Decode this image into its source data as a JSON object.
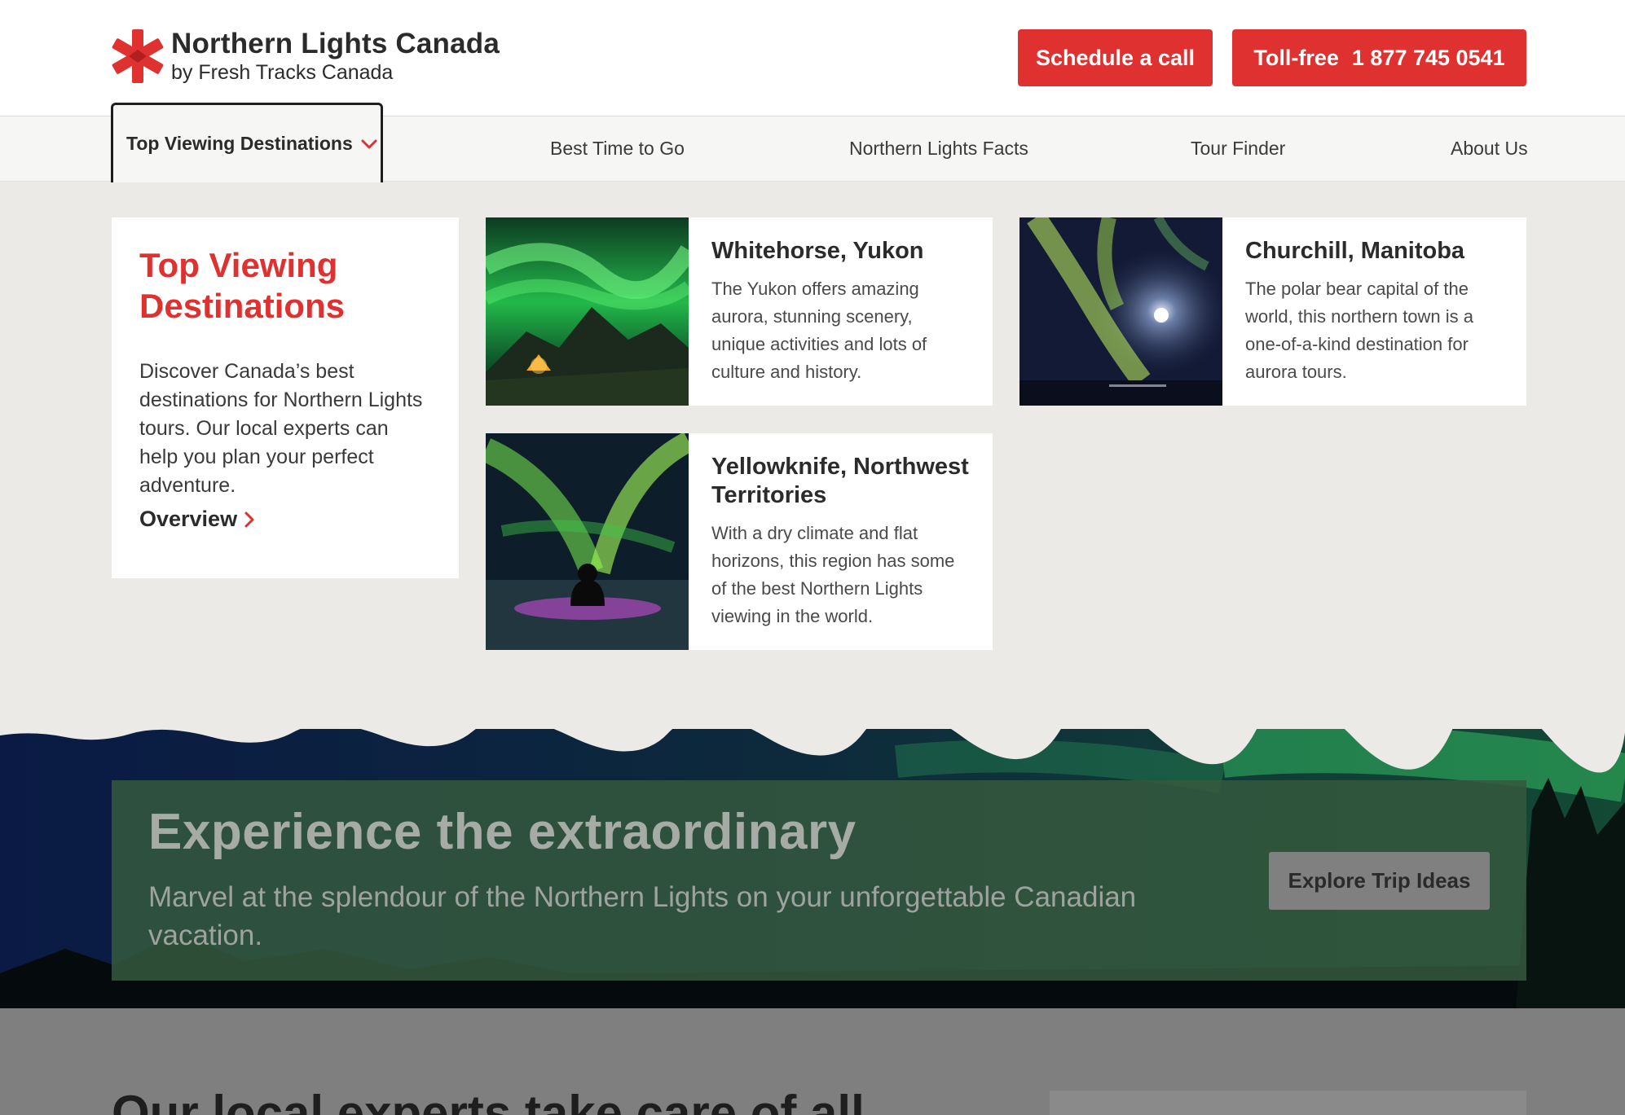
{
  "brand": {
    "title": "Northern Lights Canada",
    "subtitle": "by Fresh Tracks Canada",
    "logo_color": "#e03131"
  },
  "header": {
    "schedule_label": "Schedule a call",
    "toll_prefix": "Toll-free",
    "toll_number": "1 877 745 0541"
  },
  "nav": {
    "items": [
      {
        "label": "Top Viewing Destinations",
        "active": true
      },
      {
        "label": "Best Time to Go"
      },
      {
        "label": "Northern Lights Facts"
      },
      {
        "label": "Tour Finder"
      },
      {
        "label": "About Us"
      }
    ]
  },
  "menu": {
    "intro": {
      "title": "Top Viewing Destinations",
      "description": "Discover Canada’s best destinations for Northern Lights tours. Our local experts can help you plan your perfect adventure.",
      "link": "Overview"
    },
    "destinations": [
      {
        "title": "Whitehorse, Yukon",
        "description": "The Yukon offers amazing aurora, stunning scenery, unique activities and lots of culture and history."
      },
      {
        "title": "Churchill, Manitoba",
        "description": "The polar bear capital of the world, this northern town is a one-of-a-kind destination for aurora tours."
      },
      {
        "title": "Yellowknife, Northwest Territories",
        "description": "With a dry climate and flat horizons, this region has some of the best Northern Lights viewing in the world."
      }
    ]
  },
  "hero": {
    "title": "Experience the extraordinary",
    "subtitle": "Marvel at the splendour of the Northern Lights on your unforgettable Canadian vacation.",
    "button": "Explore Trip Ideas"
  },
  "lower": {
    "heading": "Our local experts take care of all"
  },
  "colors": {
    "accent": "#e03131",
    "page_bg": "#ebeae6",
    "hero_box": "#34583e"
  }
}
